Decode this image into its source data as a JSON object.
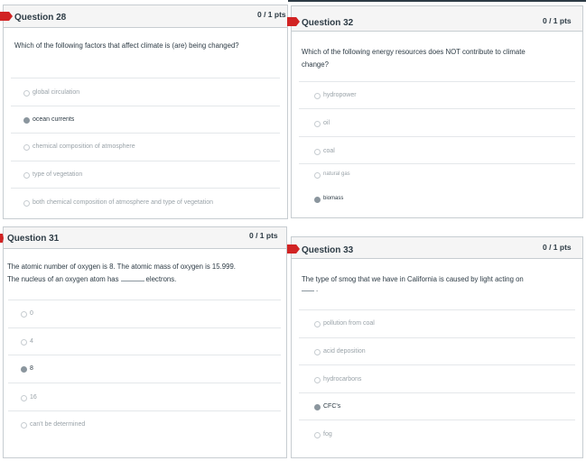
{
  "questions": [
    {
      "title": "Question 28",
      "points": "0 / 1 pts",
      "text_lines": [
        "Which of the following factors that affect climate is (are) being changed?"
      ],
      "answers": [
        {
          "label": "global circulation",
          "selected": false
        },
        {
          "label": "ocean currents",
          "selected": true
        },
        {
          "label": "chemical composition of atmosphere",
          "selected": false
        },
        {
          "label": "type of vegetation",
          "selected": false
        },
        {
          "label": "both chemical composition of atmosphere and type of vegetation",
          "selected": false
        }
      ]
    },
    {
      "title": "Question 32",
      "points": "0 / 1 pts",
      "text_lines": [
        "Which of the following energy resources does NOT contribute to climate",
        "change?"
      ],
      "answers": [
        {
          "label": "hydropower",
          "selected": false
        },
        {
          "label": "oil",
          "selected": false
        },
        {
          "label": "coal",
          "selected": false
        },
        {
          "label": "natural gas",
          "selected": false
        },
        {
          "label": "biomass",
          "selected": true
        }
      ]
    },
    {
      "title": "Question 31",
      "points": "0 / 1 pts",
      "text_line1": "The atomic number of oxygen is 8.  The atomic mass of oxygen is 15.999.",
      "text_line2_before": "The nucleus of an oxygen atom has",
      "text_line2_after": "electrons.",
      "answers": [
        {
          "label": "0",
          "selected": false
        },
        {
          "label": "4",
          "selected": false
        },
        {
          "label": "8",
          "selected": true
        },
        {
          "label": "16",
          "selected": false
        },
        {
          "label": "can't be determined",
          "selected": false
        }
      ]
    },
    {
      "title": "Question 33",
      "points": "0 / 1 pts",
      "text_line1": "The type of smog that we have in California is caused by light acting on",
      "text_line2_after": ".",
      "answers": [
        {
          "label": "pollution from coal",
          "selected": false
        },
        {
          "label": "acid deposition",
          "selected": false
        },
        {
          "label": "hydrocarbons",
          "selected": false
        },
        {
          "label": "CFC's",
          "selected": true
        },
        {
          "label": "fog",
          "selected": false
        }
      ]
    }
  ]
}
